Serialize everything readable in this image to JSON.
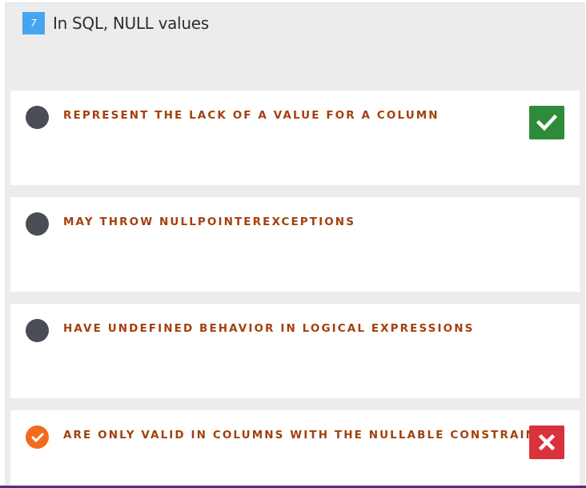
{
  "question": {
    "number": "7",
    "title": "In SQL, NULL values"
  },
  "options": [
    {
      "label": "REPRESENT THE LACK OF A VALUE FOR A COLUMN",
      "selected": false,
      "feedback": "correct-icon"
    },
    {
      "label": "MAY THROW NULLPOINTEREXCEPTIONS",
      "selected": false,
      "feedback": null
    },
    {
      "label": "HAVE UNDEFINED BEHAVIOR IN LOGICAL EXPRESSIONS",
      "selected": false,
      "feedback": null
    },
    {
      "label": "ARE ONLY VALID IN COLUMNS WITH THE NULLABLE CONSTRAINT",
      "selected": true,
      "feedback": "wrong-icon"
    }
  ],
  "colors": {
    "question_number_bg": "#45a6ef",
    "option_text": "#a4400c",
    "indicator_unselected": "#4a4d55",
    "indicator_selected": "#f26b1d",
    "correct": "#2e8b3a",
    "wrong": "#d9323b"
  }
}
